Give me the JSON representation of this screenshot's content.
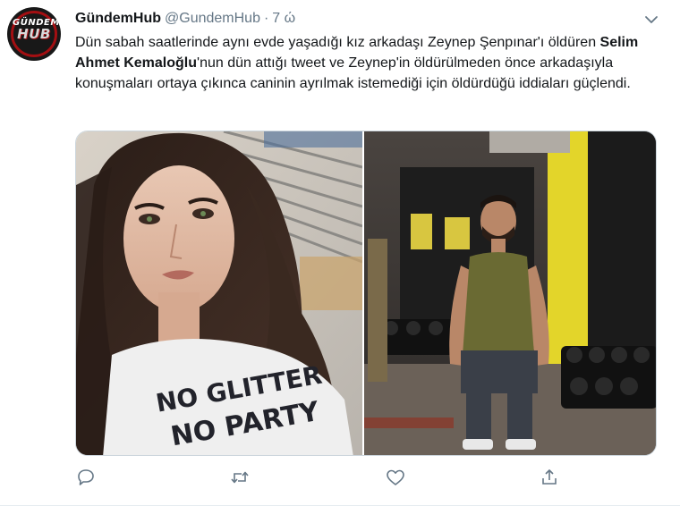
{
  "account": {
    "display_name": "GündemHub",
    "handle": "@GundemHub",
    "separator": "·",
    "time_ago": "7 ώ",
    "avatar_text_top": "GÜNDEM",
    "avatar_text_main": "HUB"
  },
  "tweet": {
    "text_part1": "Dün sabah saatlerinde aynı evde yaşadığı kız arkadaşı Zeynep Şenpınar'ı öldüren ",
    "text_bold": "Selim Ahmet Kemaloğlu",
    "text_part2": "'nun dün attığı tweet ve Zeynep'in öldürülmeden önce arkadaşıyla konuşmaları ortaya çıkınca caninin ayrılmak istemediği için öldürdüğü iddiaları güçlendi.",
    "media": {
      "left_photo": {
        "shirt_line1": "NO GLITTER",
        "shirt_line2": "NO PARTY"
      },
      "right_photo": {
        "sign_text": "..."
      }
    }
  },
  "actions": [
    {
      "name": "reply-icon"
    },
    {
      "name": "retweet-icon"
    },
    {
      "name": "like-icon"
    },
    {
      "name": "share-icon"
    }
  ],
  "colors": {
    "secondary_text": "#657786",
    "border": "#ccd6dd",
    "brand_red": "#a30f12"
  }
}
